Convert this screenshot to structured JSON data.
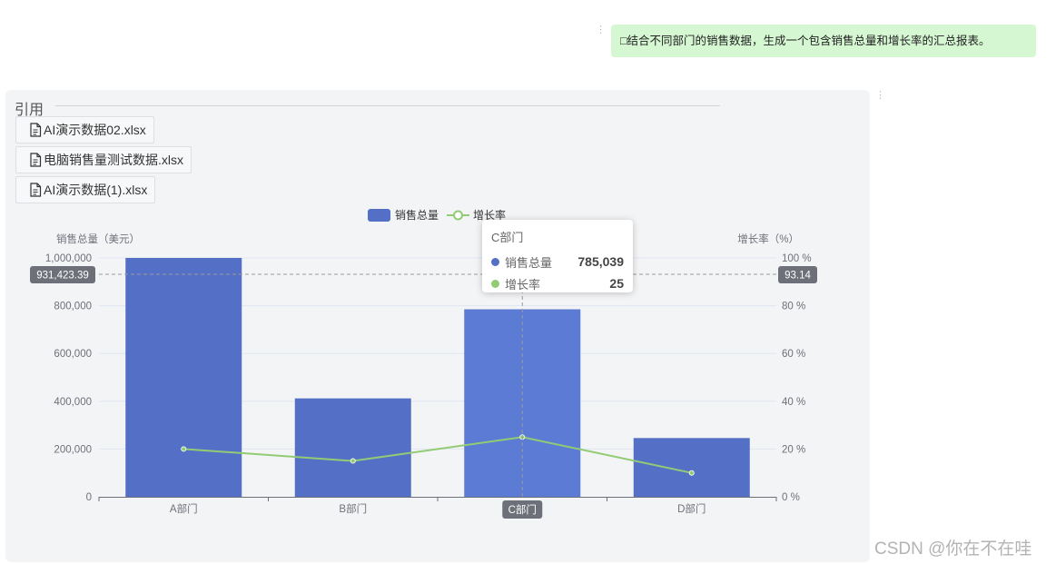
{
  "user_message": {
    "text": "□结合不同部门的销售数据，生成一个包含销售总量和增长率的汇总报表。"
  },
  "menu_icons": [
    "more-vertical-icon",
    "more-vertical-icon"
  ],
  "reply": {
    "references_title": "引用",
    "files": [
      {
        "name": "AI演示数据02.xlsx",
        "icon": "file-icon"
      },
      {
        "name": "电脑销售量测试数据.xlsx",
        "icon": "file-icon"
      },
      {
        "name": "AI演示数据(1).xlsx",
        "icon": "file-icon"
      }
    ]
  },
  "chart_data": {
    "type": "bar",
    "categories": [
      "A部门",
      "B部门",
      "C部门",
      "D部门"
    ],
    "series": [
      {
        "name": "销售总量",
        "type": "bar",
        "axis": "left",
        "color": "#5470c6",
        "values": [
          1000000,
          412000,
          785039,
          246000
        ]
      },
      {
        "name": "增长率",
        "type": "line",
        "axis": "right",
        "color": "#91cc75",
        "values": [
          20,
          15,
          25,
          10
        ]
      }
    ],
    "ylabel": "销售总量（美元）",
    "ylabel_right": "增长率（%）",
    "ylim": [
      0,
      1000000
    ],
    "ylim_right": [
      0,
      100
    ],
    "yticks": [
      "0",
      "200,000",
      "400,000",
      "600,000",
      "800,000",
      "1,000,000"
    ],
    "yticks_right": [
      "0 %",
      "20 %",
      "40 %",
      "60 %",
      "80 %",
      "100 %"
    ],
    "legend_position": "top-center",
    "grid": true,
    "axis_pointer": {
      "y_value": 931423.39,
      "y_label": "931,423.39",
      "y_right_label": "93.14",
      "x_category": "C部门"
    },
    "highlight_color": "#5b7bd5"
  },
  "tooltip": {
    "title": "C部门",
    "rows": [
      {
        "name": "销售总量",
        "value": "785,039",
        "color": "#5470c6"
      },
      {
        "name": "增长率",
        "value": "25",
        "color": "#91cc75"
      }
    ]
  },
  "watermark": "CSDN @你在不在哇"
}
